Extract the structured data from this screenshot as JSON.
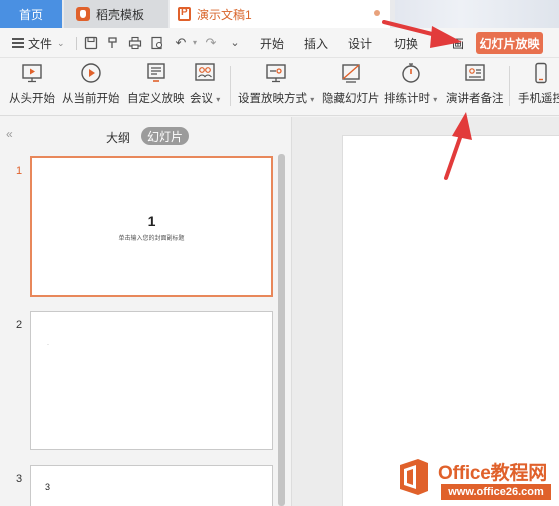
{
  "tabs": {
    "home": "首页",
    "templates": "稻壳模板",
    "document": "演示文稿1"
  },
  "menu": {
    "file": "文件",
    "items": [
      "开始",
      "插入",
      "设计",
      "切换"
    ],
    "partial": "画",
    "active": "幻灯片放映"
  },
  "ribbon": {
    "from_start": "从头开始",
    "from_current": "从当前开始",
    "custom_show": "自定义放映",
    "meeting": "会议",
    "setup_show": "设置放映方式",
    "hide_slide": "隐藏幻灯片",
    "rehearse": "排练计时",
    "presenter_notes": "演讲者备注",
    "phone_remote": "手机遥控"
  },
  "panel": {
    "outline_tab": "大纲",
    "slides_tab": "幻灯片",
    "slides": [
      {
        "number": "1",
        "title": "1",
        "subtitle": "单击输入您的封面副标题"
      },
      {
        "number": "2",
        "content": "·"
      },
      {
        "number": "3",
        "content": "3"
      }
    ]
  },
  "watermark": {
    "line1": "Office教程网",
    "line2": "www.office26.com"
  },
  "colors": {
    "accent": "#e0612b",
    "home_tab": "#4a90e2",
    "active_menu": "#e8704e",
    "arrow": "#e23b3b"
  }
}
